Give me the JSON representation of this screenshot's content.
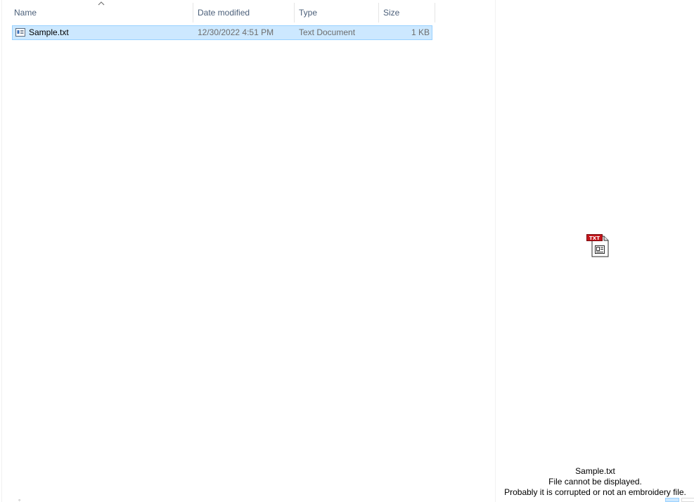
{
  "columns": {
    "name": "Name",
    "date_modified": "Date modified",
    "type": "Type",
    "size": "Size"
  },
  "sort": {
    "column": "Name",
    "direction": "ascending"
  },
  "files": [
    {
      "name": "Sample.txt",
      "date_modified": "12/30/2022 4:51 PM",
      "type": "Text Document",
      "size": "1 KB",
      "selected": true,
      "icon": "text-document-icon"
    }
  ],
  "preview": {
    "icon": "txt-file-icon",
    "icon_badge": "TXT",
    "filename": "Sample.txt",
    "message_line1": "File cannot be displayed.",
    "message_line2": "Probably it is corrupted or not an embroidery file."
  },
  "colors": {
    "selection_fill": "#cce8ff",
    "selection_border": "#99d1ff",
    "header_text": "#4c607a",
    "secondary_text": "#6d6d6d",
    "badge_red": "#c4161c"
  }
}
